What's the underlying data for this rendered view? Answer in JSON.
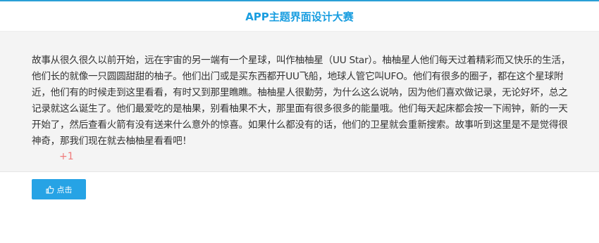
{
  "header": {
    "title": "APP主题界面设计大赛"
  },
  "content": {
    "story_text": "故事从很久很久以前开始，远在宇宙的另一端有一个星球，叫作柚柚星（UU Star）。柚柚星人他们每天过着精彩而又快乐的生活，他们长的就像一只圆圆甜甜的柚子。他们出门或是买东西都开UU飞船，地球人管它叫UFO。他们有很多的圈子，都在这个星球附近，他们有的时候走到这里看看，有时又到那里瞧瞧。柚柚星人很勤劳，为什么这么说呐，因为他们喜欢做记录，无论好坏，总之记录就这么诞生了。他们最爱吃的是柚果，别看柚果不大，那里面有很多很多的能量哦。他们每天起床都会按一下闹钟，新的一天开始了，然后查看火箭有没有送来什么意外的惊喜。如果什么都没有的话，他们的卫星就会重新搜索。故事听到这里是不是觉得很神奇，那我们现在就去柚柚星看看吧！",
    "plus_one": "+1"
  },
  "like_button": {
    "label": "点击",
    "icon": "thumbs-up-icon"
  },
  "colors": {
    "accent": "#1a9ee0",
    "button": "#26a3e5",
    "panel_bg": "#f4f4f4",
    "plus_one": "#f07a7a"
  }
}
